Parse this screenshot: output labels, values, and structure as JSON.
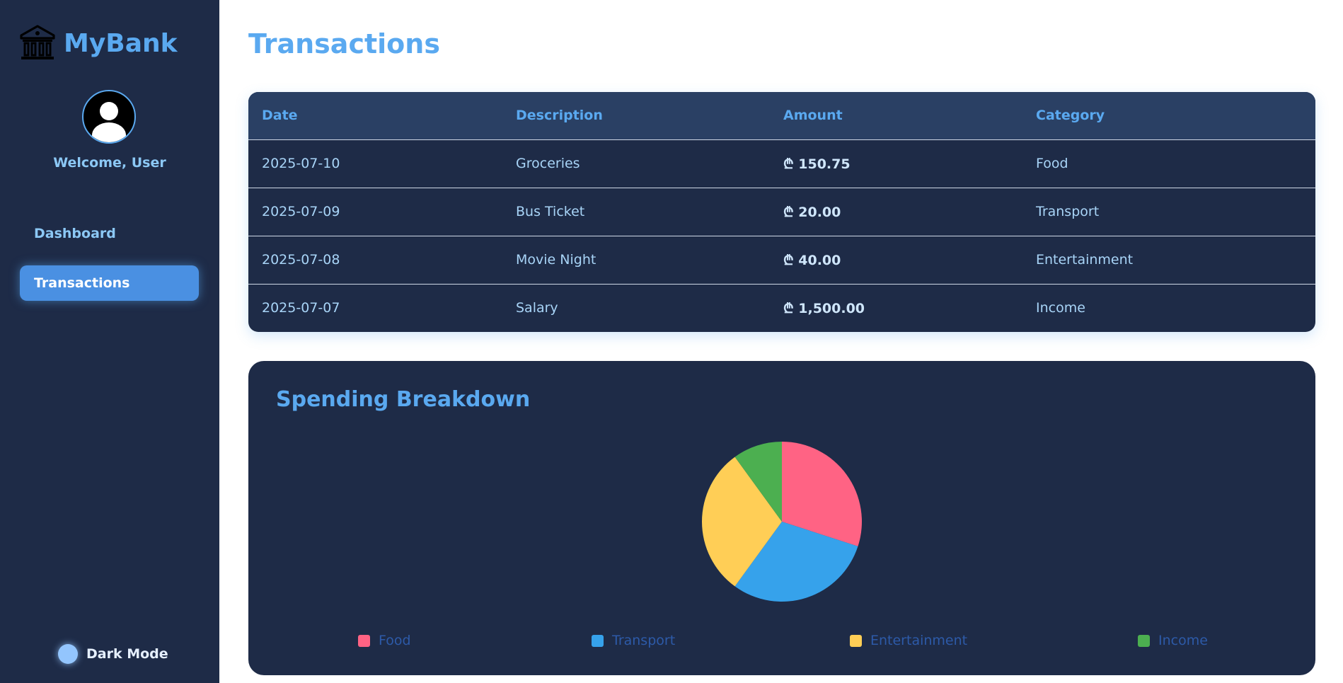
{
  "brand": {
    "name": "MyBank",
    "icon": "bank-icon"
  },
  "user": {
    "welcome": "Welcome, User",
    "avatar_icon": "user-avatar-icon"
  },
  "nav": [
    {
      "label": "Dashboard",
      "active": false
    },
    {
      "label": "Transactions",
      "active": true
    }
  ],
  "dark_mode": {
    "label": "Dark Mode"
  },
  "page": {
    "title": "Transactions"
  },
  "table": {
    "headers": [
      "Date",
      "Description",
      "Amount",
      "Category"
    ],
    "rows": [
      {
        "date": "2025-07-10",
        "description": "Groceries",
        "amount": "₾ 150.75",
        "category": "Food"
      },
      {
        "date": "2025-07-09",
        "description": "Bus Ticket",
        "amount": "₾ 20.00",
        "category": "Transport"
      },
      {
        "date": "2025-07-08",
        "description": "Movie Night",
        "amount": "₾ 40.00",
        "category": "Entertainment"
      },
      {
        "date": "2025-07-07",
        "description": "Salary",
        "amount": "₾ 1,500.00",
        "category": "Income"
      }
    ]
  },
  "chart_section": {
    "title": "Spending Breakdown"
  },
  "chart_data": {
    "type": "pie",
    "title": "Spending Breakdown",
    "categories": [
      "Food",
      "Transport",
      "Entertainment",
      "Income"
    ],
    "values": [
      30,
      30,
      30,
      10
    ],
    "colors": [
      "#ff6384",
      "#36a2eb",
      "#ffce56",
      "#4caf50"
    ],
    "legend": "bottom"
  },
  "colors": {
    "sidebar_bg": "#1e2b47",
    "accent": "#5aa9f0",
    "active_nav": "#4a90e2"
  }
}
